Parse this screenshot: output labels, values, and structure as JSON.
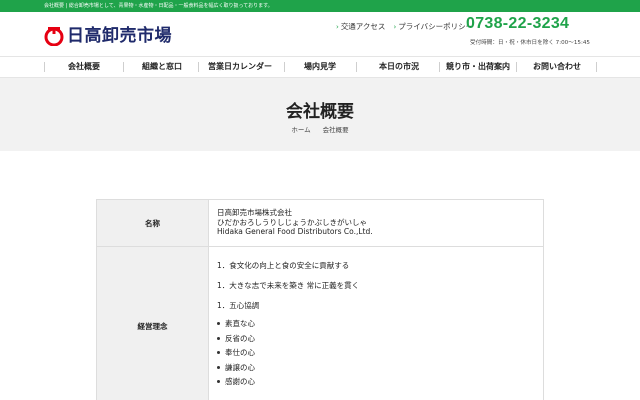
{
  "topbar": {
    "text": "会社概要 | 総合卸売市場として、青果物・水産物・日配品・一般食料品を幅広く取り扱っております。"
  },
  "header": {
    "logo_text": "日高卸売市場",
    "links": [
      {
        "label": "交通アクセス"
      },
      {
        "label": "プライバシーポリシー"
      }
    ],
    "phone": "0738-22-3234",
    "hours": "受付時間：日・祝・休市日を除く 7:00〜15:45"
  },
  "nav": {
    "items": [
      {
        "label": "会社概要"
      },
      {
        "label": "組織と窓口"
      },
      {
        "label": "営業日カレンダー"
      },
      {
        "label": "場内見学"
      },
      {
        "label": "本日の市況"
      },
      {
        "label": "競り市・出荷案内"
      },
      {
        "label": "お問い合わせ"
      }
    ]
  },
  "hero": {
    "title": "会社概要",
    "breadcrumb": [
      "ホーム",
      "会社概要"
    ]
  },
  "table": {
    "rows": [
      {
        "header": "名称",
        "lines": [
          "日高卸売市場株式会社",
          "ひだかおろしうりしじょうかぶしきがいしゃ",
          "Hidaka General Food Distributors Co.,Ltd."
        ]
      },
      {
        "header": "経営理念",
        "philosophy": [
          "1．食文化の向上と食の安全に貢献する",
          "1．大きな志で未来を築き 常に正義を貫く",
          "1．五心協調"
        ],
        "bullets": [
          "素直な心",
          "反省の心",
          "奉仕の心",
          "謙譲の心",
          "感謝の心"
        ]
      }
    ]
  },
  "colors": {
    "accent_green": "#1fa34a",
    "logo_red": "#e60012",
    "logo_navy": "#1f2a6b"
  },
  "icons": {
    "link_arrow": "arrow-right-icon",
    "logo": "logo-mark-icon"
  }
}
